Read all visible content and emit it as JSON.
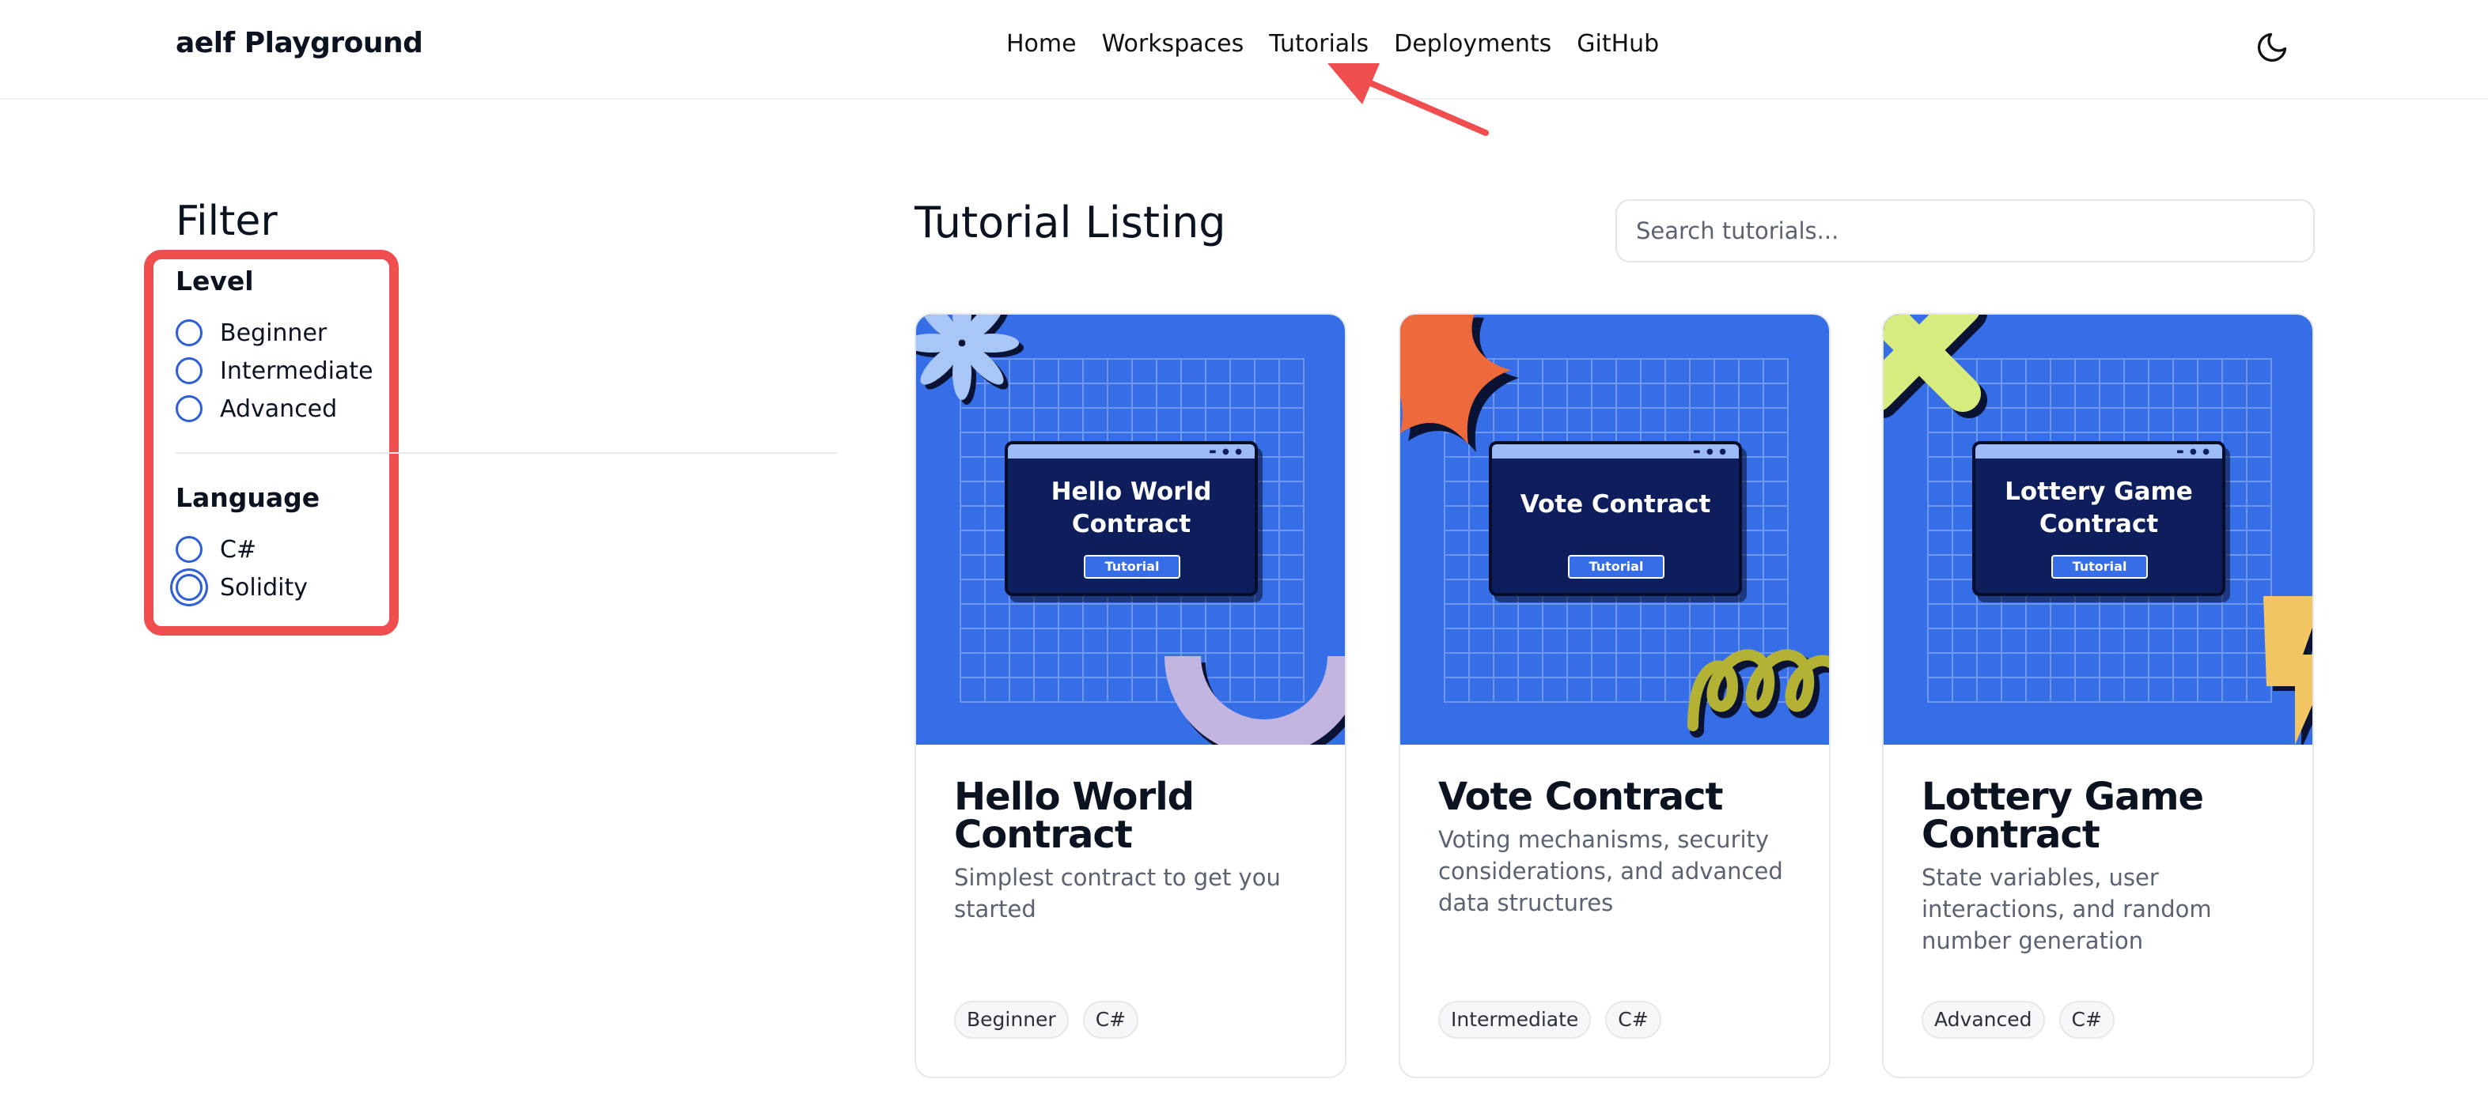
{
  "header": {
    "brand": "aelf Playground",
    "nav": [
      "Home",
      "Workspaces",
      "Tutorials",
      "Deployments",
      "GitHub"
    ],
    "theme_toggle_icon": "moon-icon"
  },
  "annotations": {
    "callout_color": "#f04e4e",
    "arrow_target": "Tutorials"
  },
  "filter": {
    "title": "Filter",
    "level": {
      "title": "Level",
      "options": [
        "Beginner",
        "Intermediate",
        "Advanced"
      ],
      "selected": null
    },
    "language": {
      "title": "Language",
      "options": [
        "C#",
        "Solidity"
      ],
      "selected": null,
      "focused": "Solidity"
    }
  },
  "main": {
    "title": "Tutorial Listing",
    "search": {
      "placeholder": "Search tutorials...",
      "value": ""
    },
    "cards": [
      {
        "image_title": "Hello World Contract",
        "image_badge": "Tutorial",
        "title": "Hello World Contract",
        "description": "Simplest contract to get you started",
        "tags": [
          "Beginner",
          "C#"
        ]
      },
      {
        "image_title": "Vote Contract",
        "image_badge": "Tutorial",
        "title": "Vote Contract",
        "description": "Voting mechanisms, security considerations, and advanced data structures",
        "tags": [
          "Intermediate",
          "C#"
        ]
      },
      {
        "image_title": "Lottery Game Contract",
        "image_badge": "Tutorial",
        "title": "Lottery Game Contract",
        "description": "State variables, user interactions, and random number generation",
        "tags": [
          "Advanced",
          "C#"
        ]
      }
    ]
  },
  "colors": {
    "accent_blue": "#356ee6",
    "radio_blue": "#2e5fd8",
    "window_navy": "#0e1d5c"
  }
}
